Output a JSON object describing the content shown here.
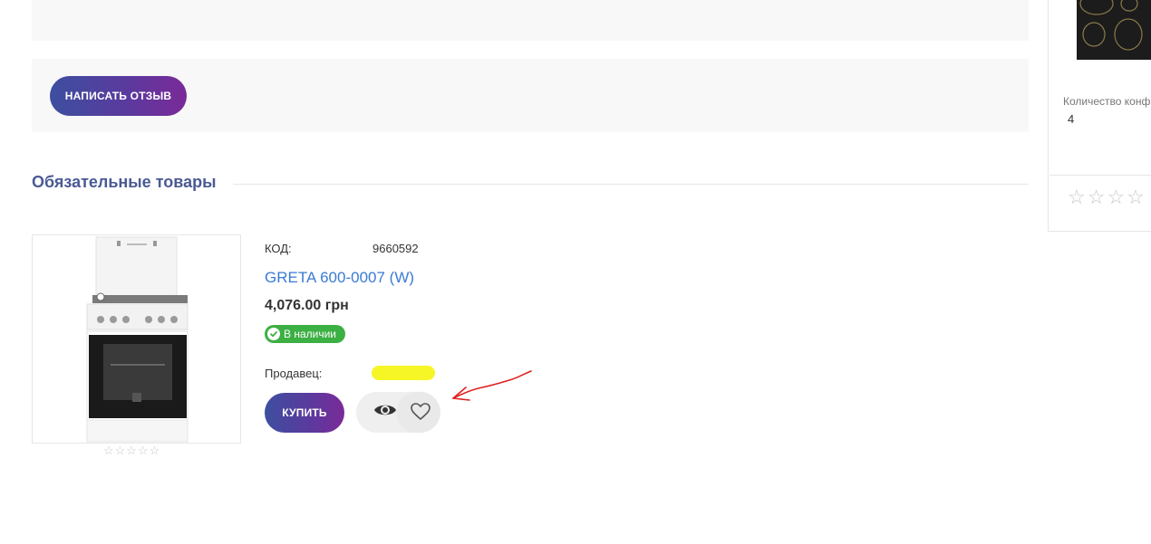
{
  "review_section": {
    "write_review_button": "НАПИСАТЬ ОТЗЫВ"
  },
  "required_products": {
    "title": "Обязательные товары",
    "product": {
      "code_label": "КОД:",
      "code_value": "9660592",
      "name": "GRETA 600-0007 (W)",
      "price": "4,076.00 грн",
      "stock_status": "В наличии",
      "seller_label": "Продавец:",
      "buy_button": "КУПИТЬ",
      "rating_stars": "☆☆☆☆☆",
      "icons": [
        "eye-icon",
        "heart-icon",
        "check-icon"
      ]
    }
  },
  "sidebar": {
    "quantity_label": "Количество конф",
    "quantity_value": "4",
    "rating_stars": "☆☆☆☆"
  },
  "colors": {
    "button_gradient_start": "#3d4f9f",
    "button_gradient_end": "#7a2a98",
    "section_title": "#4a5a94",
    "product_link": "#3a7bd5",
    "stock_badge": "#3cb043",
    "seller_highlight": "#f5f51a",
    "annotation_arrow": "#e02020"
  }
}
